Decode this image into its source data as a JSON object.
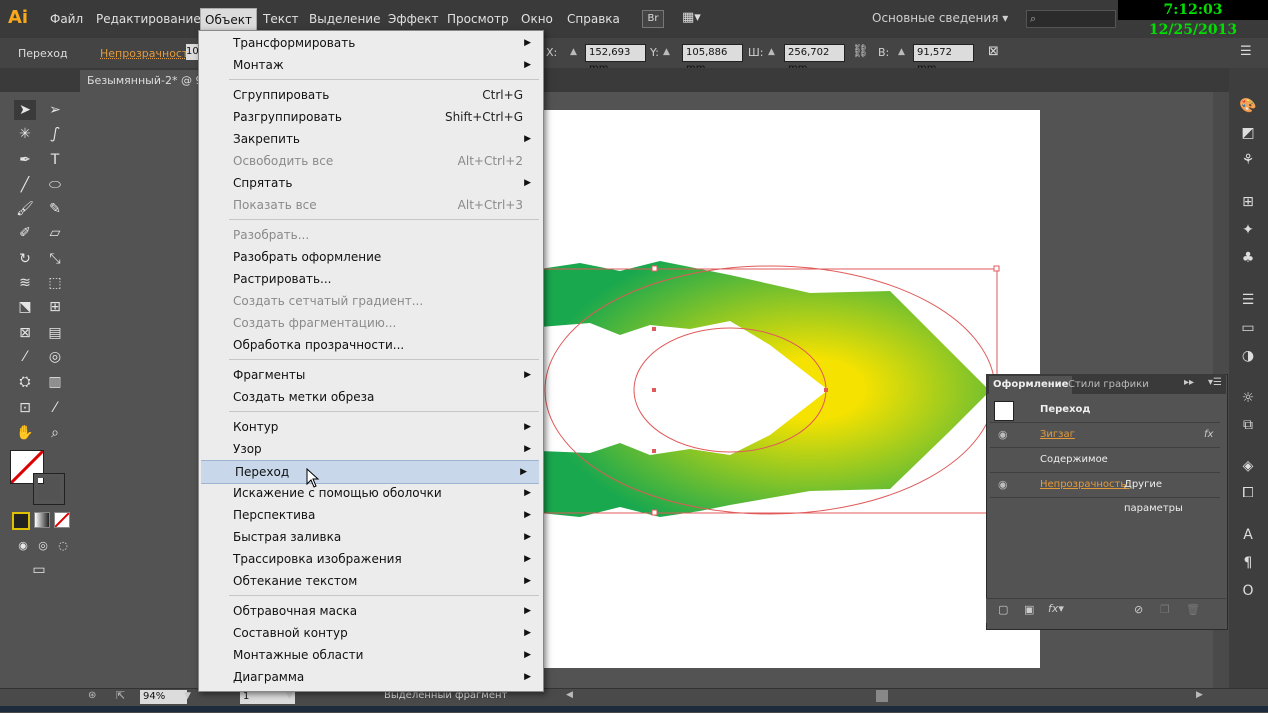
{
  "app": {
    "logo": "Ai",
    "clock": "7:12:03  12/25/2013",
    "workspace": "Основные сведения",
    "bridge": "Br"
  },
  "menubar": {
    "items": [
      "Файл",
      "Редактирование",
      "Объект",
      "Текст",
      "Выделение",
      "Эффект",
      "Просмотр",
      "Окно",
      "Справка"
    ],
    "active": "Объект"
  },
  "controlbar": {
    "label": "Переход",
    "opacity_label": "Непрозрачность:",
    "opacity_partial": "10",
    "x_label": "X:",
    "x_value": "152,693 mm",
    "y_label": "Y:",
    "y_value": "105,886 mm",
    "w_label": "Ш:",
    "w_value": "256,702 mm",
    "h_label": "В:",
    "h_value": "91,572 mm"
  },
  "document": {
    "tab_title": "Безымянный-2* @ 9"
  },
  "menu": {
    "items": [
      {
        "label": "Трансформировать",
        "submenu": true
      },
      {
        "label": "Монтаж",
        "submenu": true
      },
      {
        "separator": true
      },
      {
        "label": "Сгруппировать",
        "shortcut": "Ctrl+G"
      },
      {
        "label": "Разгруппировать",
        "shortcut": "Shift+Ctrl+G"
      },
      {
        "label": "Закрепить",
        "submenu": true
      },
      {
        "label": "Освободить все",
        "shortcut": "Alt+Ctrl+2",
        "disabled": true
      },
      {
        "label": "Спрятать",
        "submenu": true
      },
      {
        "label": "Показать все",
        "shortcut": "Alt+Ctrl+3",
        "disabled": true
      },
      {
        "separator": true
      },
      {
        "label": "Разобрать...",
        "disabled": true
      },
      {
        "label": "Разобрать оформление"
      },
      {
        "label": "Растрировать..."
      },
      {
        "label": "Создать сетчатый градиент...",
        "disabled": true
      },
      {
        "label": "Создать фрагментацию...",
        "disabled": true
      },
      {
        "label": "Обработка прозрачности..."
      },
      {
        "separator": true
      },
      {
        "label": "Фрагменты",
        "submenu": true
      },
      {
        "label": "Создать метки обреза"
      },
      {
        "separator": true
      },
      {
        "label": "Контур",
        "submenu": true
      },
      {
        "label": "Узор",
        "submenu": true
      },
      {
        "label": "Переход",
        "submenu": true,
        "highlighted": true
      },
      {
        "label": "Искажение с помощью оболочки",
        "submenu": true
      },
      {
        "label": "Перспектива",
        "submenu": true
      },
      {
        "label": "Быстрая заливка",
        "submenu": true
      },
      {
        "label": "Трассировка изображения",
        "submenu": true
      },
      {
        "label": "Обтекание текстом",
        "submenu": true
      },
      {
        "separator": true
      },
      {
        "label": "Обтравочная маска",
        "submenu": true
      },
      {
        "label": "Составной контур",
        "submenu": true
      },
      {
        "label": "Монтажные области",
        "submenu": true
      },
      {
        "label": "Диаграмма",
        "submenu": true
      }
    ]
  },
  "appearance_panel": {
    "tab_active": "Оформление",
    "tab_other": "Стили графики",
    "header": "Переход",
    "row1": "Зигзаг",
    "row1_fx": "fx",
    "row2": "Содержимое",
    "row3_label": "Непрозрачность:",
    "row3_value": "Другие параметры"
  },
  "status": {
    "zoom": "94%",
    "page": "1",
    "text": "Выделенный фрагмент"
  },
  "colors": {
    "accent_orange": "#e39a3a",
    "menu_bg": "#ececec",
    "highlight": "#c8d7ea",
    "shape_green": "#1aa84e",
    "shape_yellow": "#f5e200"
  }
}
